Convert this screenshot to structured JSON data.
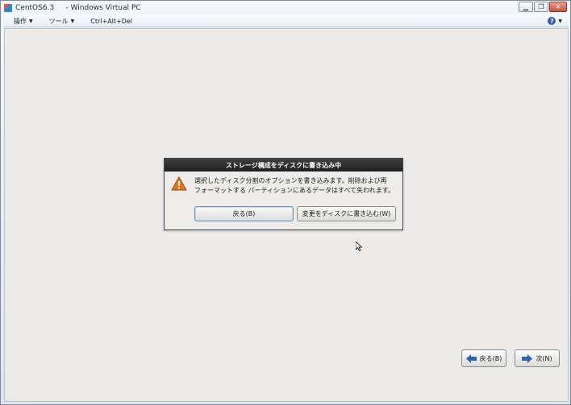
{
  "window": {
    "title": "CentOS6.3     - Windows Virtual PC",
    "controls": {
      "minimize": "▁",
      "restore": "❐",
      "close": "✕"
    }
  },
  "menubar": {
    "items": [
      {
        "label": "操作"
      },
      {
        "label": "ツール"
      },
      {
        "label": "Ctrl+Alt+Del"
      }
    ],
    "help_caret": "▼"
  },
  "dialog": {
    "title": "ストレージ構成をディスクに書き込み中",
    "message_line1": "選択したディスク分割のオプションを書き込みます。削除および再",
    "message_line2": "フォーマットする パーティションにあるデータはすべて失われます。",
    "back_button": "戻る(B)",
    "write_button": "変更をディスクに書き込む(W)",
    "icon": "warning-icon"
  },
  "nav": {
    "prev_label": "戻る(B)",
    "next_label": "次(N)"
  },
  "colors": {
    "dialog_title_bg": "#2b2b2b",
    "guest_bg": "#ecebe9",
    "warning_orange": "#e6731e",
    "nav_arrow_blue": "#2a64b3"
  }
}
